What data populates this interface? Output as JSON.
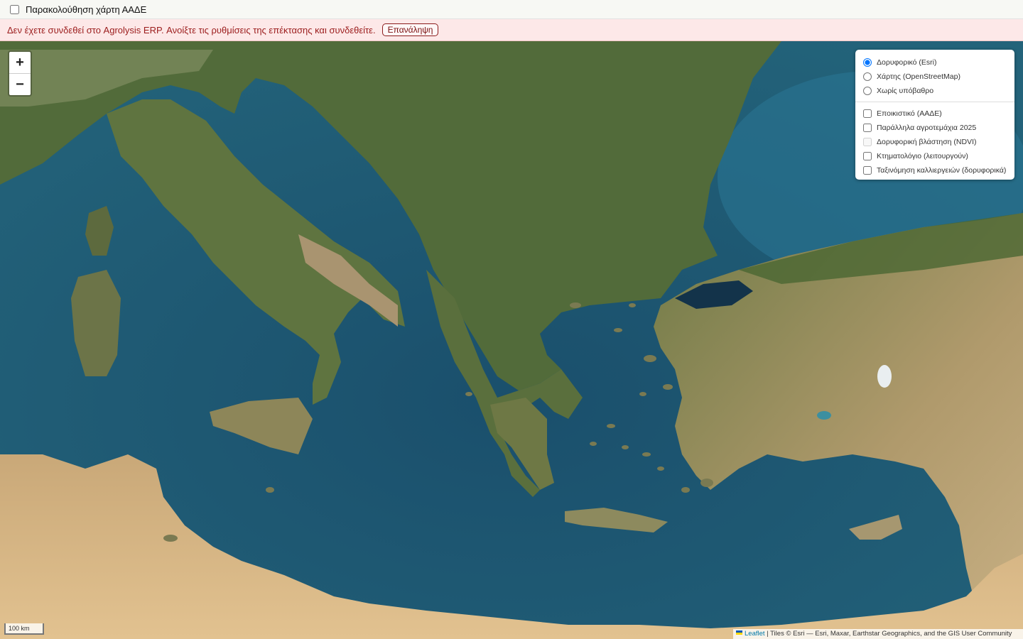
{
  "topbar": {
    "checkbox_label": "Παρακολούθηση χάρτη ΑΑΔΕ",
    "checked": false
  },
  "alert": {
    "message": "Δεν έχετε συνδεθεί στο Agrolysis ERP. Ανοίξτε τις ρυθμίσεις της επέκτασης και συνδεθείτε.",
    "retry_label": "Επανάληψη"
  },
  "zoom": {
    "in_label": "+",
    "out_label": "−"
  },
  "layers": {
    "base": [
      {
        "label": "Δορυφορικό (Esri)",
        "selected": true
      },
      {
        "label": "Χάρτης (OpenStreetMap)",
        "selected": false
      },
      {
        "label": "Χωρίς υπόβαθρο",
        "selected": false
      }
    ],
    "overlays": [
      {
        "label": "Εποικιστικό (ΑΑΔΕ)",
        "checked": false,
        "disabled": false
      },
      {
        "label": "Παράλληλα αγροτεμάχια 2025",
        "checked": false,
        "disabled": false
      },
      {
        "label": "Δορυφορική βλάστηση (NDVI)",
        "checked": false,
        "disabled": true
      },
      {
        "label": "Κτηματολόγιο (λειτουργούν)",
        "checked": false,
        "disabled": false
      },
      {
        "label": "Ταξινόμηση καλλιεργειών (δορυφορικά)",
        "checked": false,
        "disabled": false
      }
    ]
  },
  "scale": {
    "label": "100 km"
  },
  "attribution": {
    "leaflet": "Leaflet",
    "rest": "| Tiles © Esri — Esri, Maxar, Earthstar Geographics, and the GIS User Community"
  },
  "colors": {
    "sea": "#1e5a73",
    "land_green": "#4e6a34",
    "land_tan": "#b49a6a",
    "desert": "#d7b784",
    "alert_text": "#9b1c1c"
  }
}
